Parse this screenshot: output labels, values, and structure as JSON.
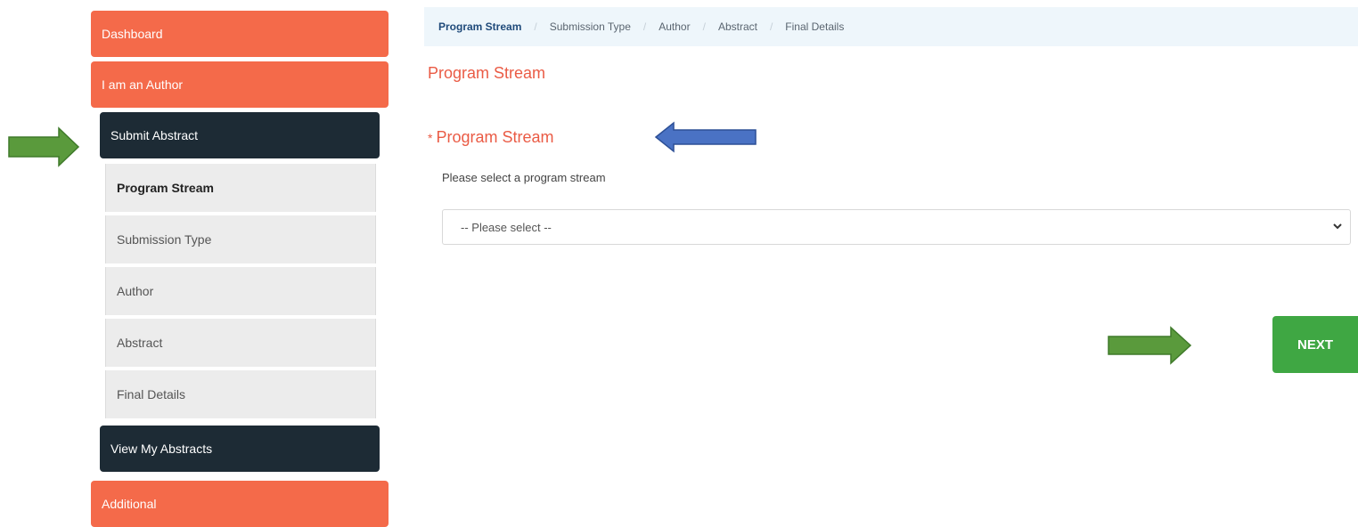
{
  "sidebar": {
    "dashboard": "Dashboard",
    "author_section": "I am an Author",
    "submit_abstract": "Submit Abstract",
    "steps": [
      "Program Stream",
      "Submission Type",
      "Author",
      "Abstract",
      "Final Details"
    ],
    "view_abstracts": "View My Abstracts",
    "additional": "Additional"
  },
  "breadcrumb": [
    "Program Stream",
    "Submission Type",
    "Author",
    "Abstract",
    "Final Details"
  ],
  "main": {
    "page_title": "Program Stream",
    "field_required_mark": "*",
    "field_label": "Program Stream",
    "field_help": "Please select a program stream",
    "select_value": "-- Please select --",
    "next_label": "NEXT"
  },
  "colors": {
    "accent_orange": "#f46a4a",
    "dark_navy": "#1d2b35",
    "next_green": "#3fa743",
    "annotation_green_arrow": "#5a9a3c",
    "annotation_blue_arrow": "#4a72c4"
  }
}
